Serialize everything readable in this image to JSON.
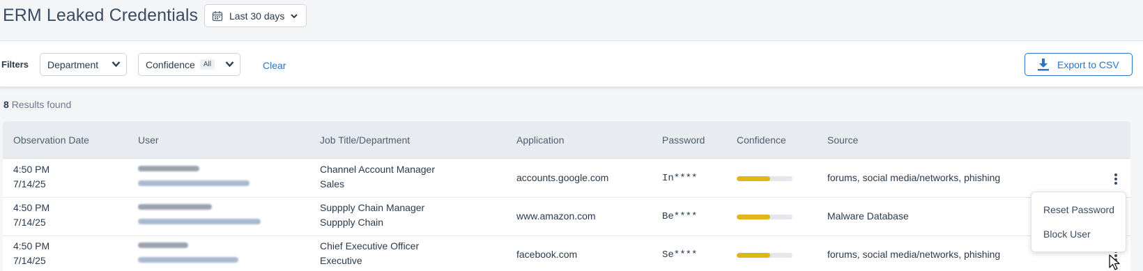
{
  "header": {
    "title": "ERM Leaked Credentials",
    "date_range": "Last 30 days",
    "date_icon": "calendar-icon"
  },
  "filters": {
    "label": "Filters",
    "department": "Department",
    "confidence": "Confidence",
    "confidence_pill": "All",
    "clear": "Clear",
    "export": "Export to CSV",
    "export_icon": "download-icon"
  },
  "results": {
    "count": "8",
    "label": "Results found"
  },
  "table": {
    "columns": [
      "Observation Date",
      "User",
      "Job Title/Department",
      "Application",
      "Password",
      "Confidence",
      "Source"
    ],
    "rows": [
      {
        "time": "4:50 PM",
        "date": "7/14/25",
        "job_title": "Channel Account Manager",
        "department": "Sales",
        "application": "accounts.google.com",
        "password": "In****",
        "confidence": 0.6,
        "source": "forums, social media/networks, phishing"
      },
      {
        "time": "4:50 PM",
        "date": "7/14/25",
        "job_title": "Suppply Chain Manager",
        "department": "Suppply Chain",
        "application": "www.amazon.com",
        "password": "Be****",
        "confidence": 0.6,
        "source": "Malware Database"
      },
      {
        "time": "4:50 PM",
        "date": "7/14/25",
        "job_title": "Chief Executive Officer",
        "department": "Executive",
        "application": "facebook.com",
        "password": "Se****",
        "confidence": 0.6,
        "source": "forums, social media/networks, phishing"
      }
    ]
  },
  "row_menu": {
    "items": [
      "Reset Password",
      "Block User"
    ]
  },
  "colors": {
    "accent": "#2a74c5",
    "confidence_bar": "#e0b61a"
  }
}
